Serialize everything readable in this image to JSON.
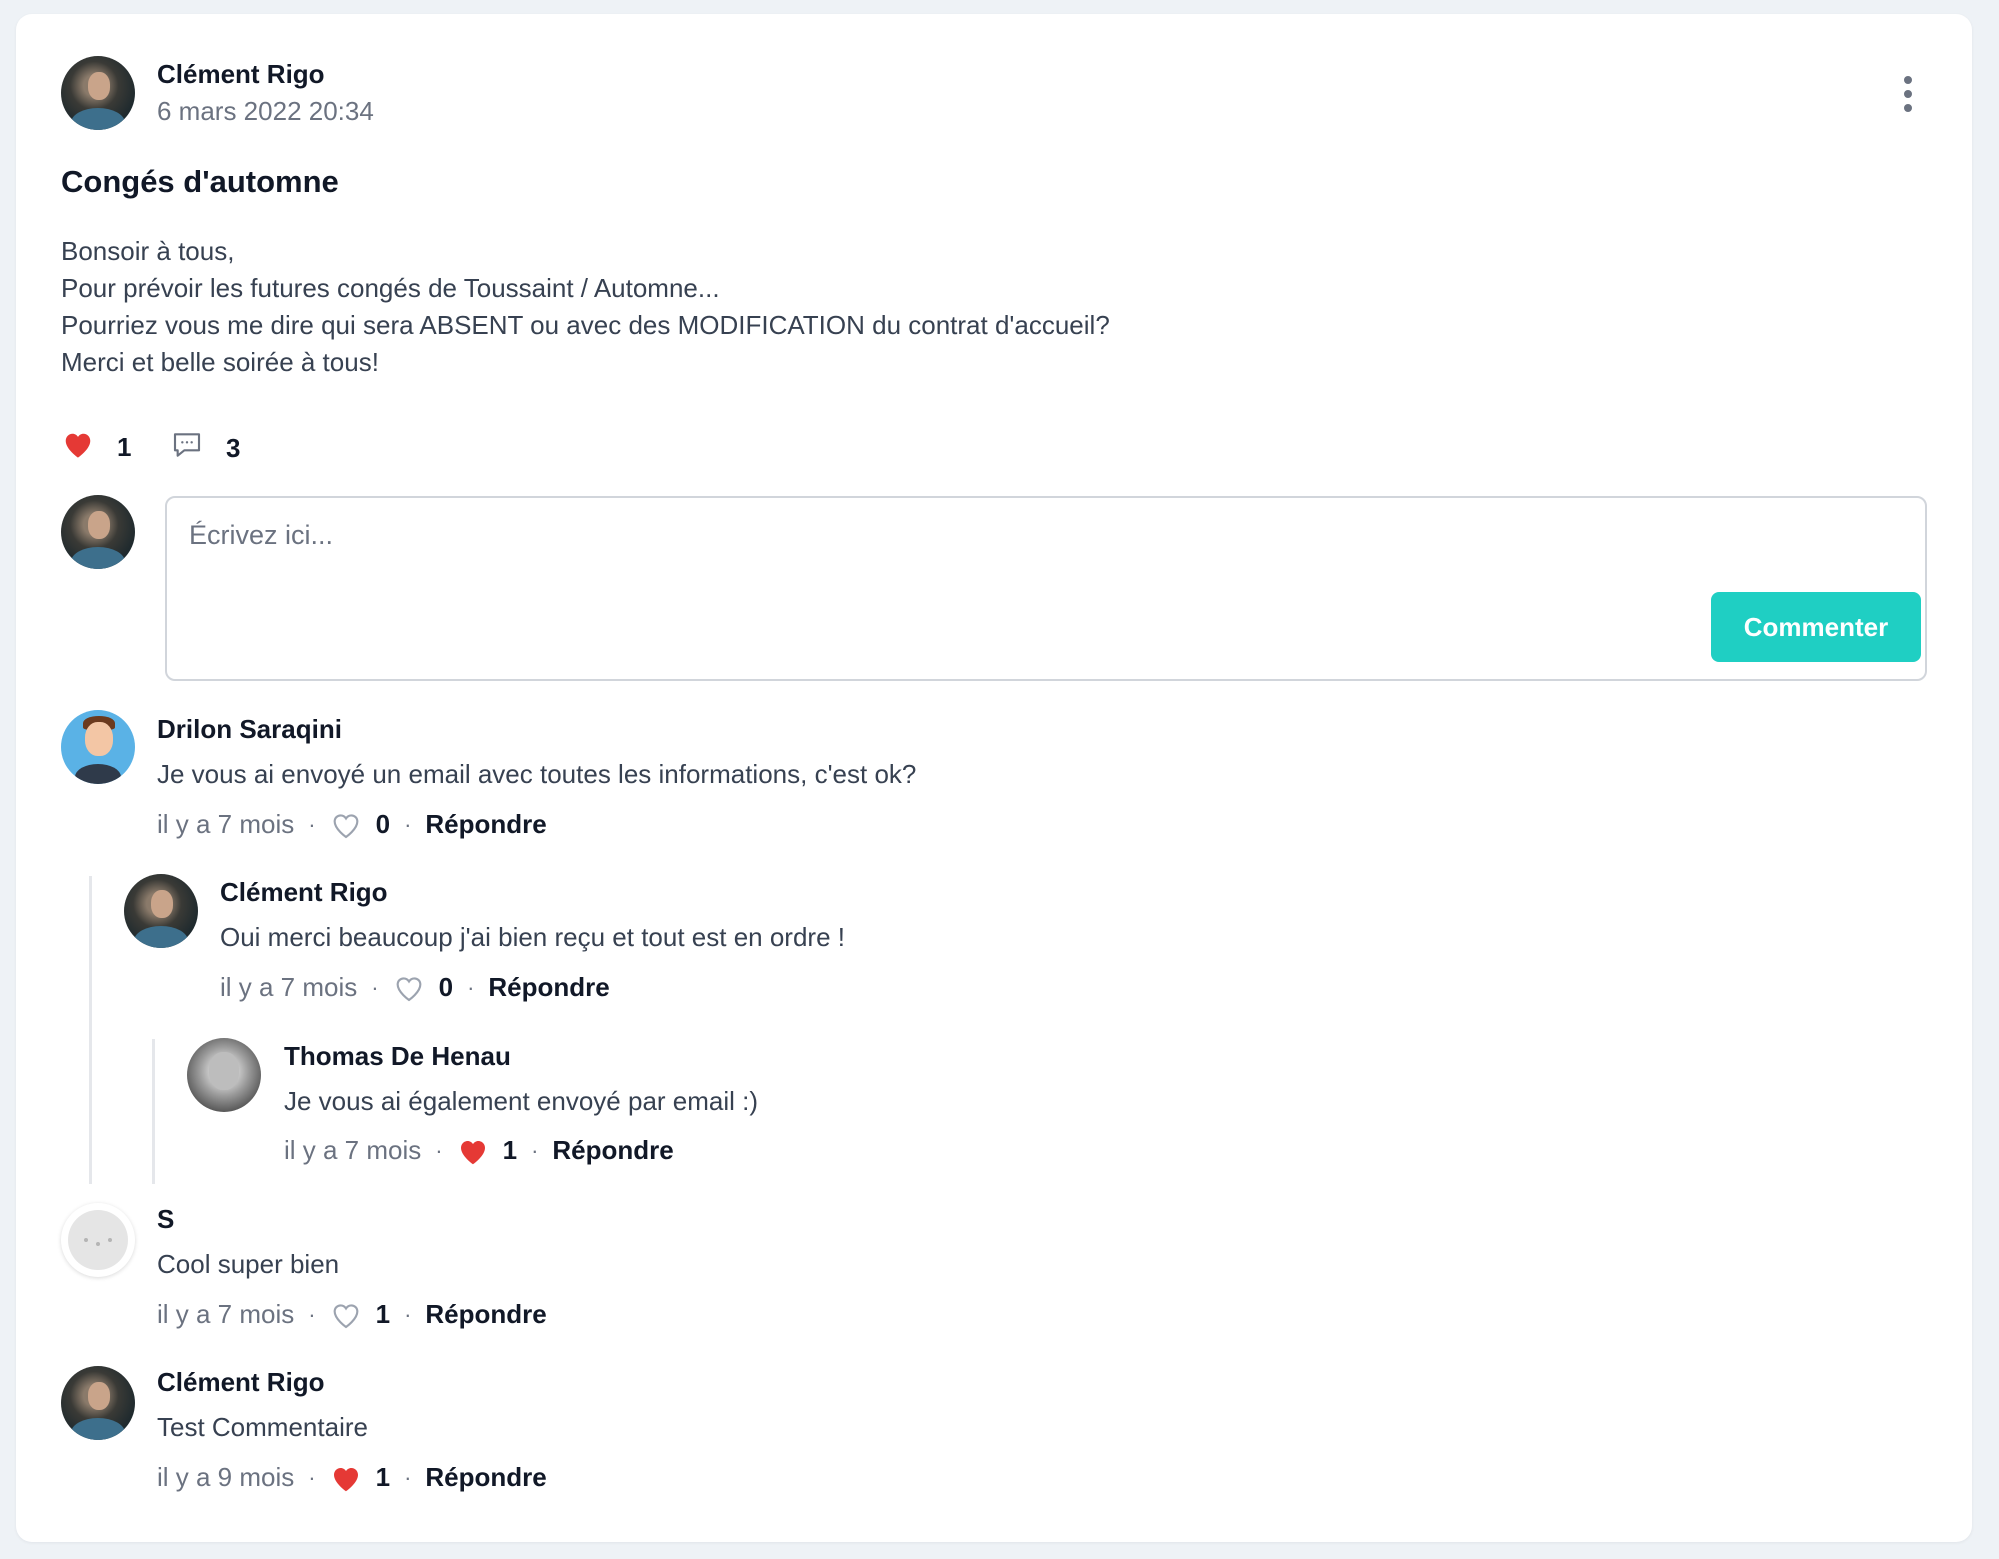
{
  "post": {
    "author": "Clément Rigo",
    "date": "6 mars 2022 20:34",
    "title": "Congés d'automne",
    "body": [
      "Bonsoir à tous,",
      "Pour prévoir les futures congés de Toussaint / Automne...",
      "Pourriez vous me dire qui sera ABSENT ou avec des MODIFICATION du contrat d'accueil?",
      "Merci et belle soirée à tous!"
    ],
    "likes": "1",
    "comments_count": "3",
    "liked": true,
    "menu_icon": "more-vertical-icon"
  },
  "composer": {
    "placeholder": "Écrivez ici...",
    "submit_label": "Commenter"
  },
  "colors": {
    "accent": "#1fcfc3",
    "like_red": "#e53935",
    "muted": "#6b7280",
    "thread_line": "#e5e7eb"
  },
  "comments": [
    {
      "author": "Drilon Saraqini",
      "text": "Je vous ai envoyé un email avec toutes les informations, c'est ok?",
      "time": "il y a 7 mois",
      "likes": "0",
      "liked": false,
      "reply_label": "Répondre",
      "replies": [
        {
          "author": "Clément Rigo",
          "text": "Oui merci beaucoup j'ai bien reçu et tout est en ordre !",
          "time": "il y a 7 mois",
          "likes": "0",
          "liked": false,
          "reply_label": "Répondre",
          "replies": [
            {
              "author": "Thomas De Henau",
              "text": "Je vous ai également envoyé par email :)",
              "time": "il y a 7 mois",
              "likes": "1",
              "liked": true,
              "reply_label": "Répondre"
            }
          ]
        }
      ]
    },
    {
      "author": "S",
      "text": "Cool super bien",
      "time": "il y a 7 mois",
      "likes": "1",
      "liked": false,
      "reply_label": "Répondre"
    },
    {
      "author": "Clément Rigo",
      "text": "Test Commentaire",
      "time": "il y a 9 mois",
      "likes": "1",
      "liked": true,
      "reply_label": "Répondre"
    }
  ],
  "separator": "·"
}
